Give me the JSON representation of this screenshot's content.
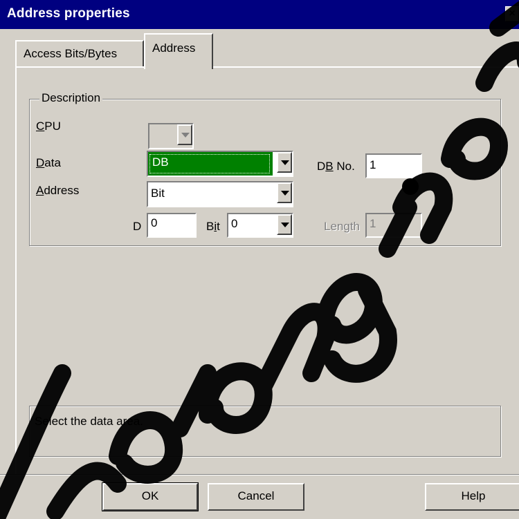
{
  "window": {
    "title": "Address properties",
    "close_label": "×"
  },
  "tabs": [
    {
      "label": "Access Bits/Bytes"
    },
    {
      "label": "Address"
    }
  ],
  "description_group": {
    "legend": "Description",
    "cpu": {
      "label_first": "C",
      "label_rest": "PU",
      "value": ""
    },
    "data": {
      "label_first": "D",
      "label_rest": "ata",
      "value": "DB"
    },
    "db_no": {
      "label_pre": "D",
      "label_underlined": "B",
      "label_post": " No.",
      "value": "1"
    },
    "address": {
      "label_first": "A",
      "label_rest": "ddress",
      "value": "Bit"
    },
    "d": {
      "label": "D",
      "value": "0"
    },
    "bit": {
      "label_pre": "B",
      "label_underlined": "i",
      "label_post": "t",
      "value": "0"
    },
    "length": {
      "label": "Length",
      "value": "1"
    }
  },
  "status": {
    "text": "Select the data area."
  },
  "buttons": {
    "ok": "OK",
    "cancel": "Cancel",
    "help": "Help"
  },
  "colors": {
    "title_bar": "#000080",
    "dialog_bg": "#d4d0c8",
    "selection": "#008000"
  }
}
